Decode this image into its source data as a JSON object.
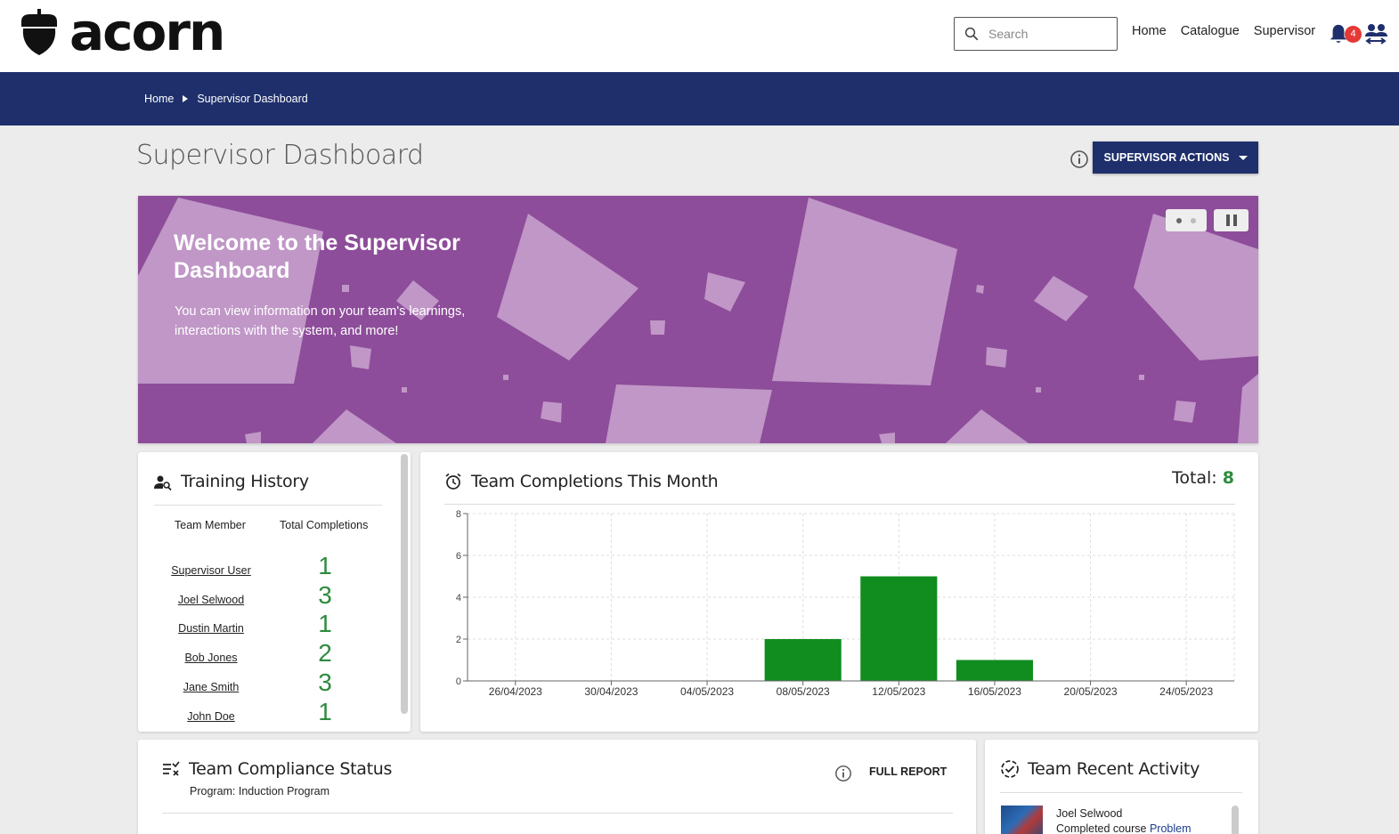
{
  "header": {
    "logo_text": "acorn",
    "search_placeholder": "Search",
    "nav": [
      "Home",
      "Catalogue",
      "Supervisor"
    ],
    "notification_count": "4"
  },
  "breadcrumb": [
    "Home",
    "Supervisor Dashboard"
  ],
  "page": {
    "title": "Supervisor Dashboard",
    "actions_label": "SUPERVISOR ACTIONS"
  },
  "banner": {
    "title": "Welcome to the Supervisor Dashboard",
    "text": "You can view information on your team's learnings, interactions with the system, and more!",
    "color": "#8d4d9a"
  },
  "training_history": {
    "title": "Training History",
    "col_member": "Team Member",
    "col_total": "Total Completions",
    "rows": [
      {
        "name": "Supervisor User",
        "total": "1"
      },
      {
        "name": "Joel Selwood",
        "total": "3"
      },
      {
        "name": "Dustin Martin",
        "total": "1"
      },
      {
        "name": "Bob Jones",
        "total": "2"
      },
      {
        "name": "Jane Smith",
        "total": "3"
      },
      {
        "name": "John Doe",
        "total": "1"
      }
    ]
  },
  "completions": {
    "title": "Team Completions This Month",
    "total_label": "Total:",
    "total_value": "8"
  },
  "chart_data": {
    "type": "bar",
    "categories": [
      "26/04/2023",
      "28/04/2023",
      "30/04/2023",
      "02/05/2023",
      "04/05/2023",
      "06/05/2023",
      "08/05/2023",
      "10/05/2023",
      "12/05/2023",
      "14/05/2023",
      "16/05/2023",
      "18/05/2023",
      "20/05/2023",
      "22/05/2023",
      "24/05/2023",
      "26/05/2023"
    ],
    "tick_labels": [
      "26/04/2023",
      "30/04/2023",
      "04/05/2023",
      "08/05/2023",
      "12/05/2023",
      "16/05/2023",
      "20/05/2023",
      "24/05/2023"
    ],
    "bars": [
      {
        "x": "08/05/2023",
        "value": 2
      },
      {
        "x": "12/05/2023",
        "value": 5
      },
      {
        "x": "16/05/2023",
        "value": 1
      }
    ],
    "ylim": [
      0,
      8
    ],
    "yticks": [
      0,
      2,
      4,
      6,
      8
    ],
    "grid": true,
    "bar_color": "#118c1f"
  },
  "compliance": {
    "title": "Team Compliance Status",
    "program": "Program: Induction Program",
    "full_report": "FULL REPORT"
  },
  "activity": {
    "title": "Team Recent Activity",
    "items": [
      {
        "who": "Joel Selwood",
        "action": "Completed course",
        "link": "Problem"
      }
    ]
  }
}
